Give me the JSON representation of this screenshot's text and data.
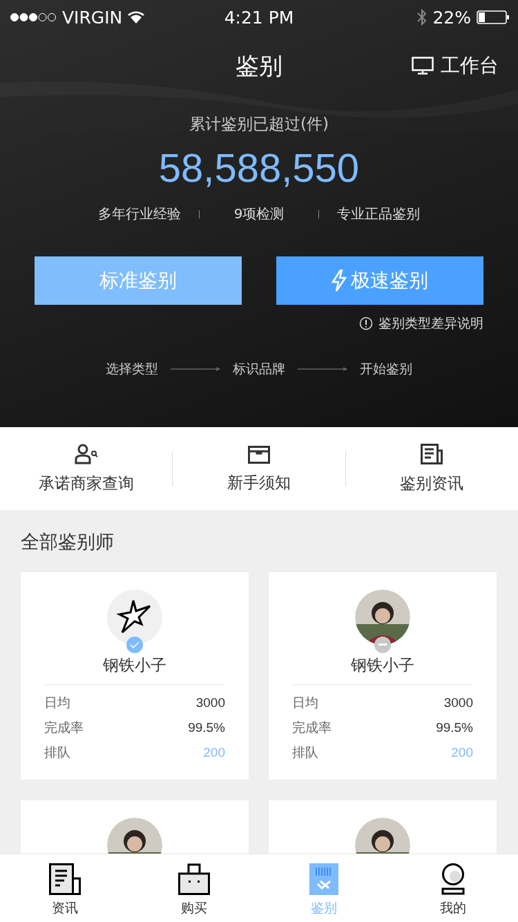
{
  "status_bar": {
    "carrier": "VIRGIN",
    "time": "4:21 PM",
    "battery": "22%"
  },
  "nav": {
    "title": "鉴别",
    "action": "工作台"
  },
  "summary": {
    "caption": "累计鉴别已超过(件)",
    "count": "58,588,550",
    "features": [
      "多年行业经验",
      "9项检测",
      "专业正品鉴别"
    ]
  },
  "buttons": [
    {
      "label": "标准鉴别",
      "kind": "standard"
    },
    {
      "label": "极速鉴别",
      "kind": "express"
    }
  ],
  "note": "鉴别类型差异说明",
  "steps": [
    "选择类型",
    "标识品牌",
    "开始鉴别"
  ],
  "links": [
    {
      "label": "承诺商家查询",
      "kind": "merchant"
    },
    {
      "label": "新手须知",
      "kind": "guide"
    },
    {
      "label": "鉴别资讯",
      "kind": "news"
    }
  ],
  "section_title": "全部鉴别师",
  "appraisers": [
    {
      "avatar": {
        "kind": "logo"
      },
      "badge": {
        "kind": "verified"
      },
      "name": "钢铁小子",
      "stats": [
        {
          "label": "日均",
          "value": "3000",
          "highlight": false
        },
        {
          "label": "完成率",
          "value": "99.5%",
          "highlight": false
        },
        {
          "label": "排队",
          "value": "200",
          "highlight": true
        }
      ]
    },
    {
      "avatar": {
        "kind": "picture"
      },
      "badge": {
        "kind": "busy"
      },
      "name": "钢铁小子",
      "stats": [
        {
          "label": "日均",
          "value": "3000",
          "highlight": false
        },
        {
          "label": "完成率",
          "value": "99.5%",
          "highlight": false
        },
        {
          "label": "排队",
          "value": "200",
          "highlight": true
        }
      ]
    },
    {
      "avatar": {
        "kind": "picture"
      }
    },
    {
      "avatar": {
        "kind": "picture"
      }
    }
  ],
  "tab_bar": [
    {
      "label": "资讯",
      "kind": "news",
      "selected": false
    },
    {
      "label": "购买",
      "kind": "shop",
      "selected": false
    },
    {
      "label": "鉴别",
      "kind": "appraise",
      "selected": true
    },
    {
      "label": "我的",
      "kind": "me",
      "selected": false
    }
  ]
}
